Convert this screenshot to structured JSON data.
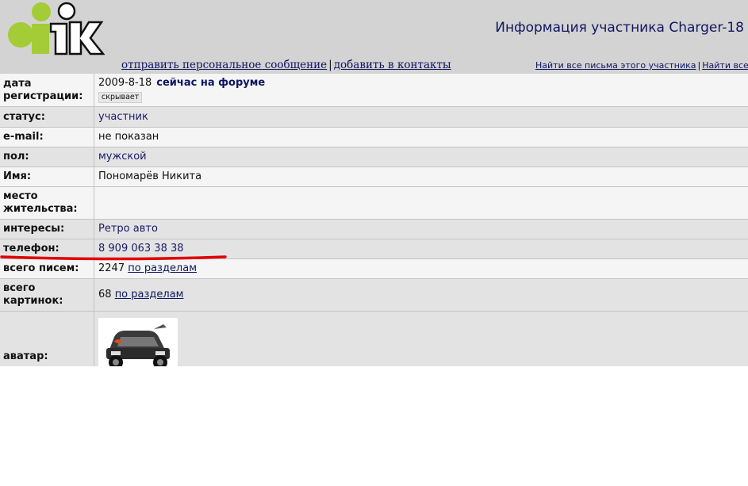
{
  "header": {
    "title": "Информация участника Charger-18",
    "actions": {
      "send_message": "отправить персональное сообщение",
      "add_contact": "добавить в контакты",
      "separator": "|"
    },
    "search": {
      "find_posts": "Найти все письма этого участника",
      "find_more": "Найти все",
      "separator": "|"
    }
  },
  "profile": {
    "registration": {
      "label": "дата регистрации:",
      "date": "2009-8-18",
      "online": "сейчас на форуме",
      "hidden_badge": "скрывает"
    },
    "status": {
      "label": "статус:",
      "value": "участник"
    },
    "email": {
      "label": "e-mail:",
      "value": "не показан"
    },
    "gender": {
      "label": "пол:",
      "value": "мужской"
    },
    "name": {
      "label": "Имя:",
      "value": "Пономарёв Никита"
    },
    "location": {
      "label": "место жительства:",
      "value": ""
    },
    "interests": {
      "label": "интересы:",
      "value": "Ретро авто"
    },
    "phone": {
      "label": "телефон:",
      "value": "8 909 063 38 38"
    },
    "posts": {
      "label": "всего писем:",
      "count": "2247",
      "link": "по разделам"
    },
    "pictures": {
      "label": "всего картинок:",
      "count": "68",
      "link": "по разделам"
    },
    "avatar": {
      "label": "аватар:",
      "icon": "cartoon-car-avatar"
    }
  },
  "colors": {
    "header_bg": "#d3d3d3",
    "link": "#0f1660",
    "row_light": "#f5f5f5",
    "row_dark": "#e3e3e3",
    "annotation": "#e00000"
  }
}
